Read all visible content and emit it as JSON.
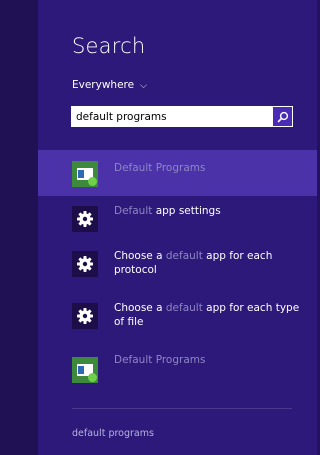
{
  "charm": {
    "title": "Search",
    "scope_label": "Everywhere",
    "scope_chevron": "⌵",
    "search": {
      "value": "default programs",
      "button_icon": "search-icon"
    }
  },
  "results": [
    {
      "pre": "",
      "mid": "Default Programs",
      "post": "",
      "icon": "default-programs-icon",
      "selected": true
    },
    {
      "pre": "Default",
      "mid": " app settings",
      "post": "",
      "icon": "gear-icon",
      "selected": false
    },
    {
      "pre": "Choose a ",
      "mid": "default",
      "post": " app for each protocol",
      "icon": "gear-icon",
      "selected": false
    },
    {
      "pre": "Choose a ",
      "mid": "default",
      "post": " app for each type of file",
      "icon": "gear-icon",
      "selected": false
    },
    {
      "pre": "",
      "mid": "Default Programs",
      "post": "",
      "icon": "default-programs-icon",
      "selected": false
    }
  ],
  "suggestion": "default programs",
  "colors": {
    "background": "#2d1979",
    "selected": "#4b32a8",
    "text": "#ffffff",
    "dim_text": "#8f86c4"
  }
}
